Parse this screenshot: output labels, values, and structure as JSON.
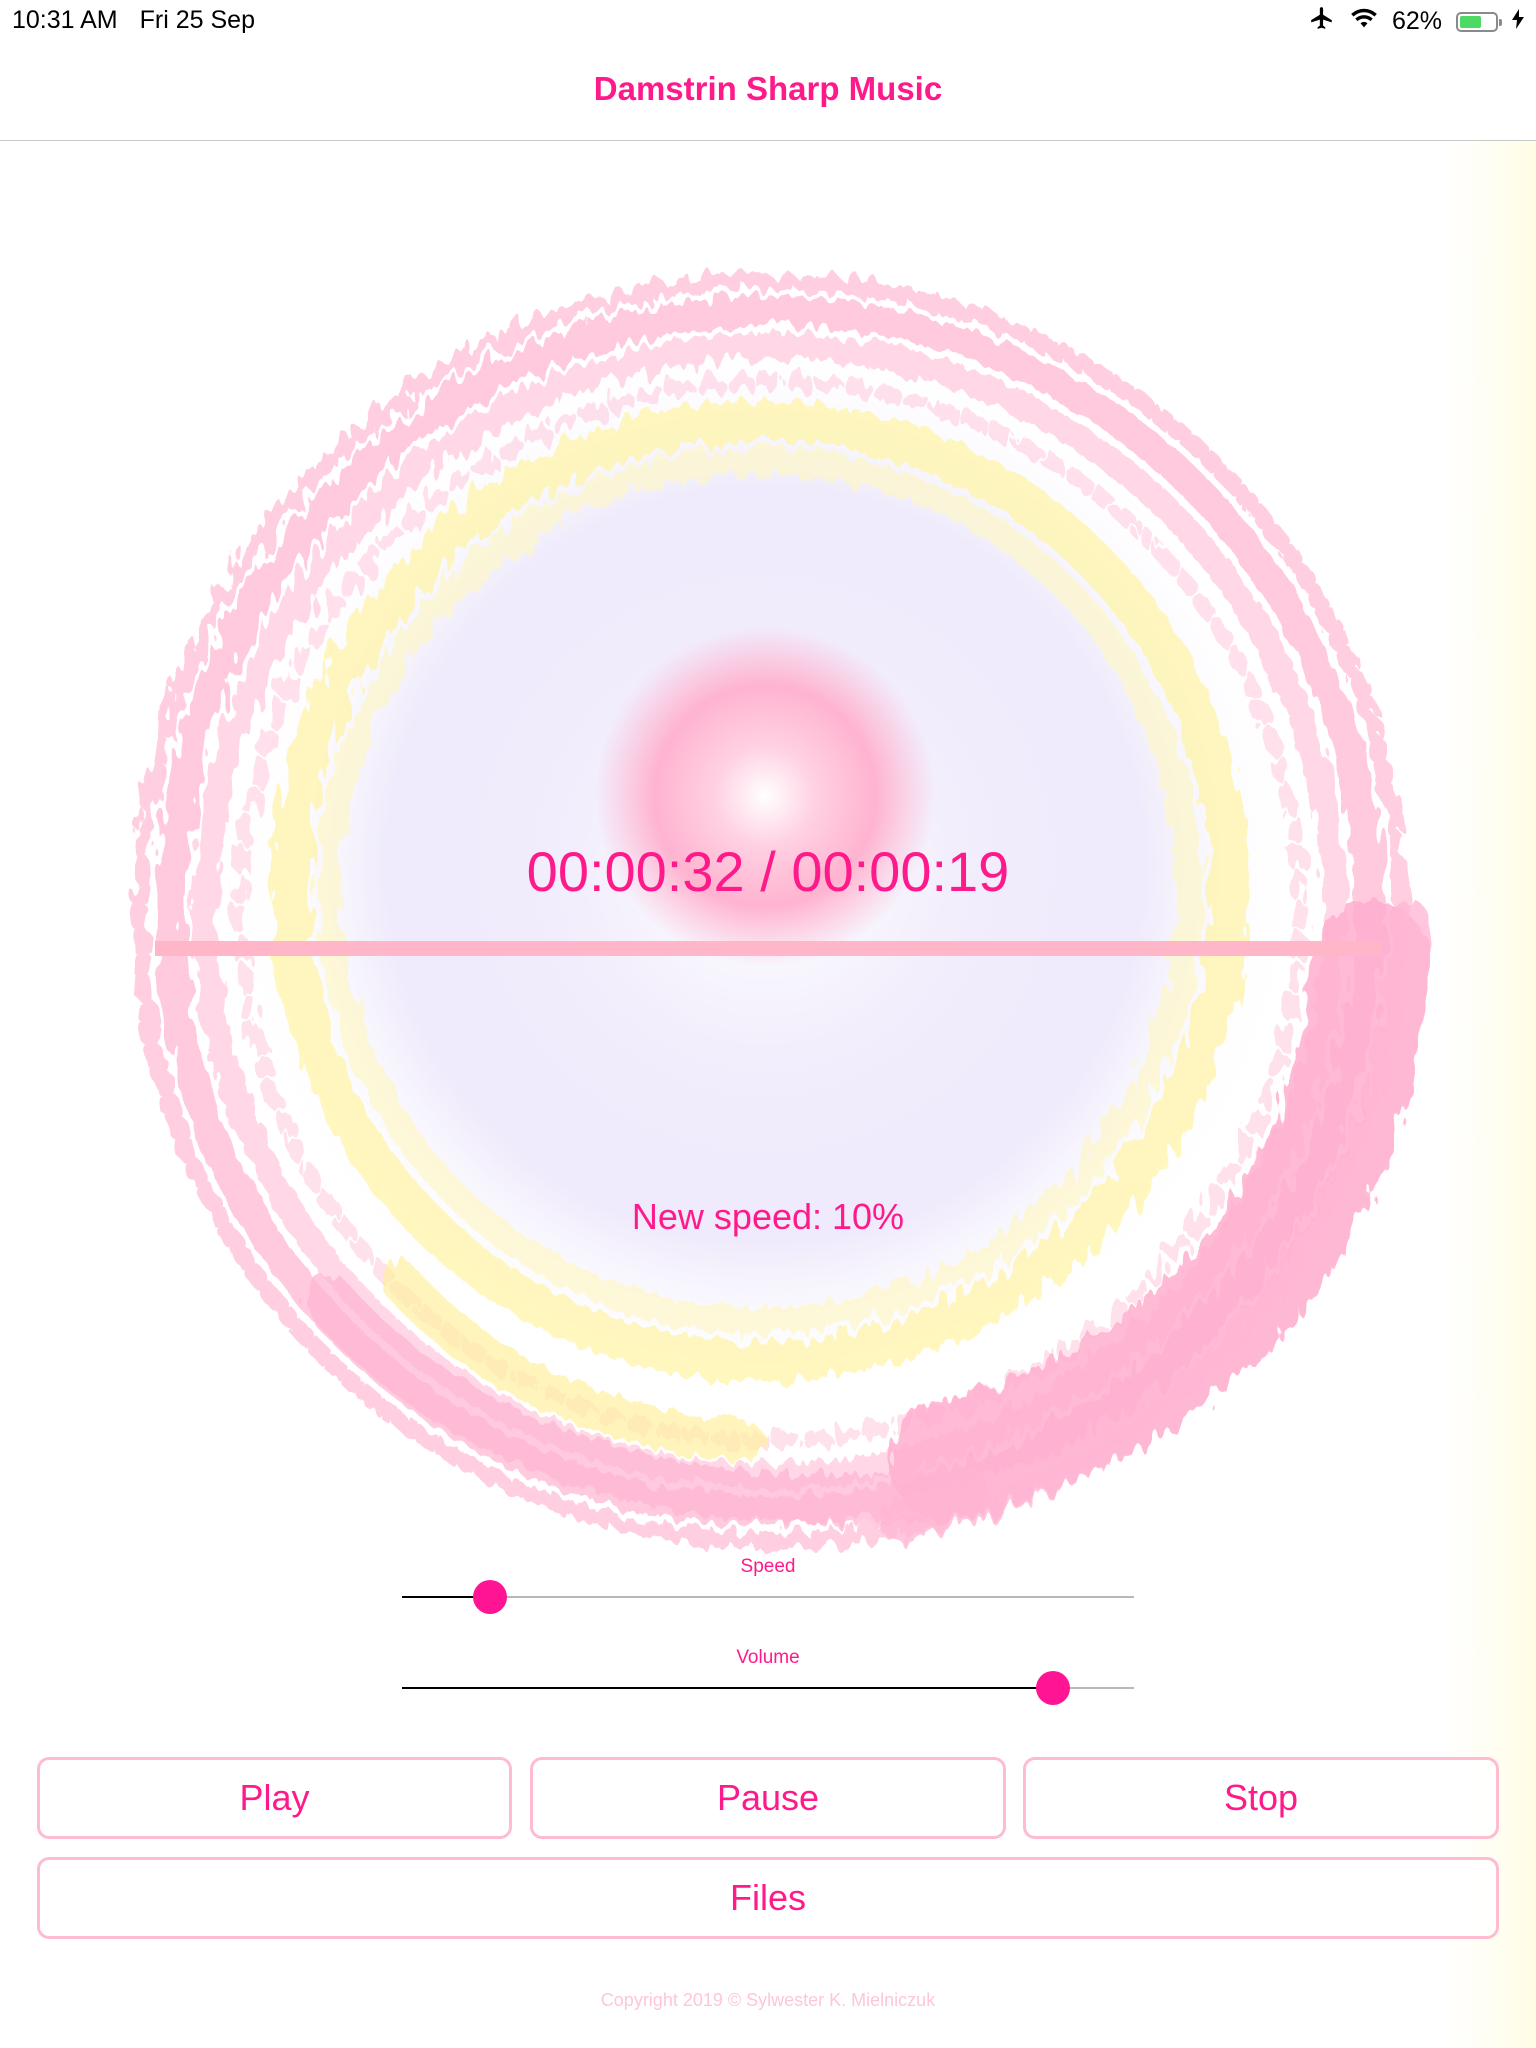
{
  "status_bar": {
    "time": "10:31 AM",
    "date": "Fri 25 Sep",
    "battery_percent": "62%",
    "battery_level": 0.62,
    "icons": [
      "airplane-icon",
      "wifi-icon",
      "battery-icon",
      "charging-bolt-icon"
    ]
  },
  "nav": {
    "title": "Damstrin Sharp Music"
  },
  "player": {
    "time_text": "00:00:32 / 00:00:19",
    "progress_fraction": 1.0,
    "speed_text": "New speed: 10%"
  },
  "sliders": {
    "speed": {
      "label": "Speed",
      "value": 0.12
    },
    "volume": {
      "label": "Volume",
      "value": 0.89
    }
  },
  "buttons": {
    "play": "Play",
    "pause": "Pause",
    "stop": "Stop",
    "files": "Files"
  },
  "footer": {
    "copyright": "Copyright 2019 © Sylwester K. Mielniczuk"
  },
  "colors": {
    "accent": "#ff1a8c",
    "thumb": "#ff1493",
    "button_border": "#ffbcd0",
    "progress": "#ffb6c8",
    "battery": "#4cd964"
  }
}
